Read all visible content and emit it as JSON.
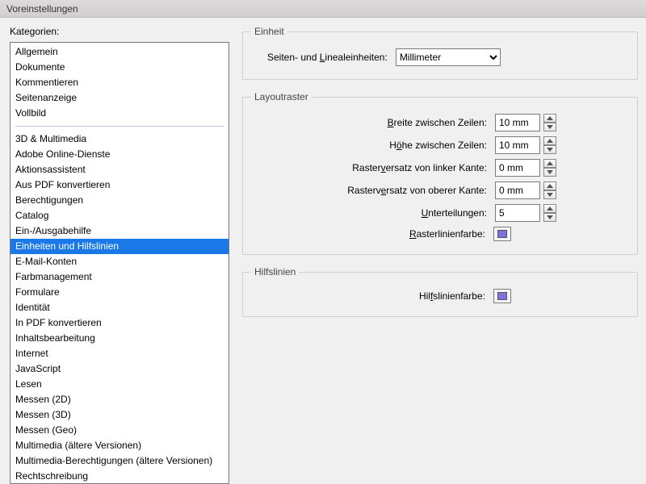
{
  "window": {
    "title": "Voreinstellungen"
  },
  "left": {
    "label": "Kategorien:",
    "group1": [
      "Allgemein",
      "Dokumente",
      "Kommentieren",
      "Seitenanzeige",
      "Vollbild"
    ],
    "group2": [
      "3D & Multimedia",
      "Adobe Online-Dienste",
      "Aktionsassistent",
      "Aus PDF konvertieren",
      "Berechtigungen",
      "Catalog",
      "Ein-/Ausgabehilfe",
      "Einheiten und Hilfslinien",
      "E-Mail-Konten",
      "Farbmanagement",
      "Formulare",
      "Identität",
      "In PDF konvertieren",
      "Inhaltsbearbeitung",
      "Internet",
      "JavaScript",
      "Lesen",
      "Messen (2D)",
      "Messen (3D)",
      "Messen (Geo)",
      "Multimedia (ältere Versionen)",
      "Multimedia-Berechtigungen (ältere Versionen)",
      "Rechtschreibung"
    ],
    "selected": "Einheiten und Hilfslinien"
  },
  "right": {
    "unit": {
      "legend": "Einheit",
      "label_pre": "Seiten- und ",
      "label_u": "L",
      "label_post": "inealeinheiten:",
      "value": "Millimeter"
    },
    "grid": {
      "legend": "Layoutraster",
      "width": {
        "pre": "",
        "u": "B",
        "post": "reite zwischen Zeilen:",
        "value": "10 mm"
      },
      "height": {
        "pre": "H",
        "u": "ö",
        "post": "he zwischen Zeilen:",
        "value": "10 mm"
      },
      "offsetLeft": {
        "pre": "Raster",
        "u": "v",
        "post": "ersatz von linker Kante:",
        "value": "0 mm"
      },
      "offsetTop": {
        "pre": "Rasterv",
        "u": "e",
        "post": "rsatz von oberer Kante:",
        "value": "0 mm"
      },
      "subdiv": {
        "pre": "",
        "u": "U",
        "post": "nterteilungen:",
        "value": "5"
      },
      "color": {
        "pre": "",
        "u": "R",
        "post": "asterlinienfarbe:",
        "swatch": "#7a72e0"
      }
    },
    "guides": {
      "legend": "Hilfslinien",
      "color": {
        "pre": "Hil",
        "u": "f",
        "post": "slinienfarbe:",
        "swatch": "#7a72e0"
      }
    }
  }
}
